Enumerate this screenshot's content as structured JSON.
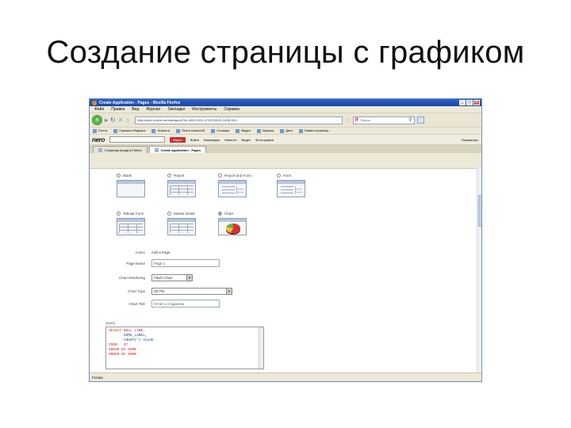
{
  "slide": {
    "title": "Создание страницы с графиком"
  },
  "window": {
    "title": "Create Application - Pages - Mozilla Firefox",
    "buttons": [
      "_",
      "□",
      "x"
    ]
  },
  "menubar": [
    "Файл",
    "Правка",
    "Вид",
    "Журнал",
    "Закладки",
    "Инструменты",
    "Справка"
  ],
  "navbar": {
    "back": "‹",
    "url": "http://apex.oracle.com/pls/apex/f?p=4000:1001:4718720921 0436::NO:::",
    "search_engine": "Я",
    "search_placeholder": "Яндекс"
  },
  "bookmarks": [
    "Почта",
    "Сервисы Яндекса",
    "Новости",
    "Лента новостей",
    "Словари",
    "Видео",
    "Музыка",
    "Диск",
    "Новая страница..."
  ],
  "nerobar": {
    "logo": "nero",
    "video_label": "Видео",
    "items": [
      "Войти",
      "Википедия",
      "Новости",
      "Видео",
      "Фотографии"
    ],
    "right": "Параметры"
  },
  "tabs": [
    {
      "label": "Страница входа в Firefox",
      "active": false
    },
    {
      "label": "Create Application - Pages",
      "active": true
    }
  ],
  "page_types": [
    {
      "label": "Blank",
      "checked": false,
      "thumb": "blank"
    },
    {
      "label": "Report",
      "checked": false,
      "thumb": "grid"
    },
    {
      "label": "Report and Form",
      "checked": false,
      "thumb": "form"
    },
    {
      "label": "Form",
      "checked": false,
      "thumb": "form"
    },
    {
      "label": "Tabular Form",
      "checked": false,
      "thumb": "grid"
    },
    {
      "label": "Master Detail",
      "checked": false,
      "thumb": "grid"
    },
    {
      "label": "Chart",
      "checked": true,
      "thumb": "pie"
    }
  ],
  "form": {
    "action_label": "Action",
    "action_value": "Add a Page",
    "page_name_label": "Page Name",
    "page_name_value": "Page 1",
    "chart_rendering_label": "Chart Rendering",
    "chart_rendering_value": "Flash Chart",
    "chart_type_label": "Chart Type",
    "chart_type_value": "3D Pie",
    "chart_title_label": "Chart Title",
    "chart_title_value": "Отчет о студентах",
    "query_label": "Query"
  },
  "query_lines": [
    "SELECT NULL LINK,",
    "       SOME_LABEL,",
    "       COUNT(*) VALUE",
    "FROM   ST",
    "GROUP BY SOME",
    "ORDER BY SOME"
  ],
  "status": "Готово",
  "colors": {
    "titlebar": "#2c62c8",
    "radio_checked": "#333333"
  }
}
